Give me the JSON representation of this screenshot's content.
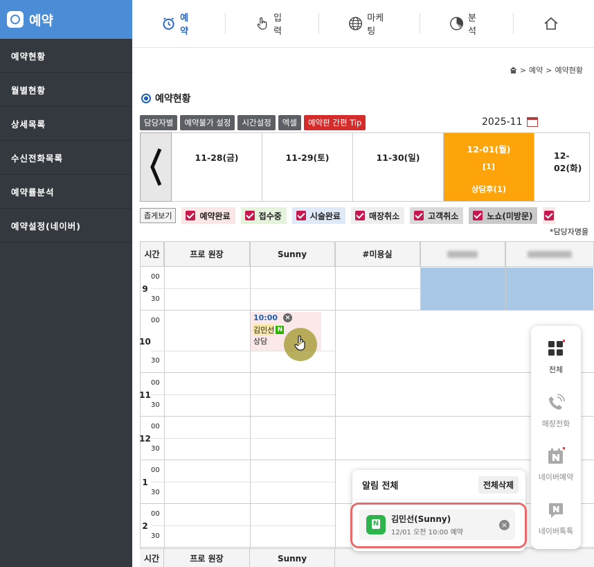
{
  "sidebar": {
    "brand": "예약",
    "items": [
      "예약현황",
      "월별현황",
      "상세목록",
      "수신전화목록",
      "예약률분석",
      "예약설정(네이버)"
    ]
  },
  "topnav": {
    "items": [
      {
        "label": "예약",
        "icon": "alarm-clock-icon",
        "active": true
      },
      {
        "label": "입력",
        "icon": "hand-pointer-icon",
        "active": false
      },
      {
        "label": "마케팅",
        "icon": "globe-icon",
        "active": false
      },
      {
        "label": "분석",
        "icon": "pie-chart-icon",
        "active": false
      }
    ]
  },
  "breadcrumb": [
    "예약",
    "예약현황"
  ],
  "page_title": "예약현황",
  "toolbar": {
    "buttons": [
      "담당자별",
      "예약불가 설정",
      "시간설정",
      "엑셀"
    ],
    "tip_button": "예약판 간편 Tip"
  },
  "month": "2025-11",
  "dates": [
    {
      "label": "11-28(금)"
    },
    {
      "label": "11-29(토)"
    },
    {
      "label": "11-30(일)"
    },
    {
      "label": "12-01(월)",
      "count": "[1]",
      "status": "상담후(1)",
      "today": true
    },
    {
      "label": "12-02(화)"
    }
  ],
  "filters": {
    "fold": "좁게보기",
    "chips": [
      {
        "label": "예약완료",
        "bg": "#fbe6e6"
      },
      {
        "label": "접수중",
        "bg": "#e6f3dc"
      },
      {
        "label": "시술완료",
        "bg": "#dfe9f8"
      },
      {
        "label": "매장취소",
        "bg": "#eeeeee"
      },
      {
        "label": "고객취소",
        "bg": "#dadada"
      },
      {
        "label": "노쇼(미방문)",
        "bg": "#c9c9c9"
      }
    ]
  },
  "note": "*담당자명을",
  "grid": {
    "time_header": "시간",
    "columns": [
      "프로 원장",
      "Sunny",
      "#미용실"
    ],
    "hours": [
      "9",
      "10",
      "11",
      "12",
      "1",
      "2"
    ],
    "minutes": [
      "00",
      "30"
    ]
  },
  "booking": {
    "time": "10:00",
    "name": "김민선",
    "badge": "N",
    "status": "상담"
  },
  "sidepanel": {
    "items": [
      "전체",
      "매장전화",
      "네이버예약",
      "네이버톡톡"
    ]
  },
  "notification": {
    "title": "알림 전체",
    "delete_all": "전체삭제",
    "item_title": "김민선(Sunny)",
    "item_desc": "12/01 오전 10:00 예약"
  },
  "colors": {
    "accent": "#4a8cd6",
    "today": "#fca40a",
    "sidebar": "#34393f",
    "highlight": "#e86a6a"
  }
}
